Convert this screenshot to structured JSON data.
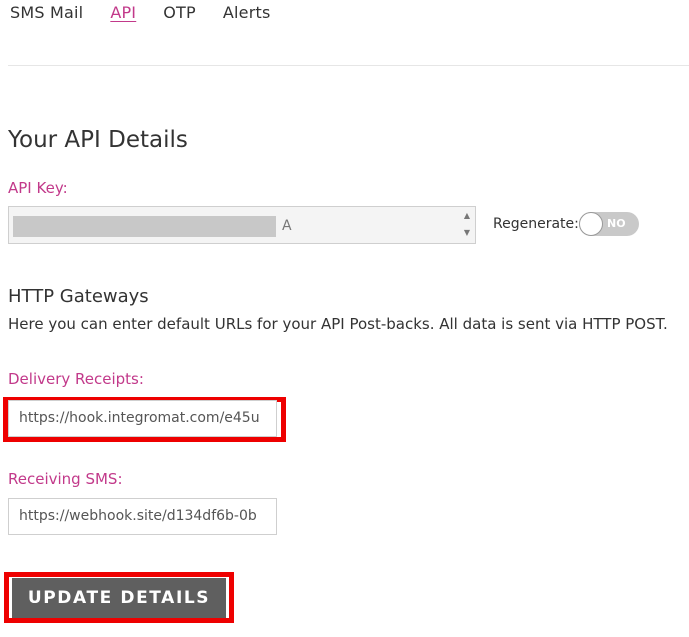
{
  "tabs": [
    {
      "label": "SMS Mail",
      "active": false
    },
    {
      "label": "API",
      "active": true
    },
    {
      "label": "OTP",
      "active": false
    },
    {
      "label": "Alerts",
      "active": false
    }
  ],
  "section_title": "Your API Details",
  "api_key": {
    "label": "API Key:",
    "value_visible_suffix": "A"
  },
  "regenerate": {
    "label": "Regenerate:",
    "toggle_text": "NO"
  },
  "http_gateways": {
    "title": "HTTP Gateways",
    "description": "Here you can enter default URLs for your API Post-backs. All data is sent via HTTP POST."
  },
  "delivery_receipts": {
    "label": "Delivery Receipts:",
    "value": "https://hook.integromat.com/e45u"
  },
  "receiving_sms": {
    "label": "Receiving SMS:",
    "value": "https://webhook.site/d134df6b-0b"
  },
  "update_button": {
    "label": "UPDATE DETAILS"
  },
  "colors": {
    "accent": "#c2398a",
    "highlight": "#ee0000",
    "button": "#5f5f5f"
  }
}
